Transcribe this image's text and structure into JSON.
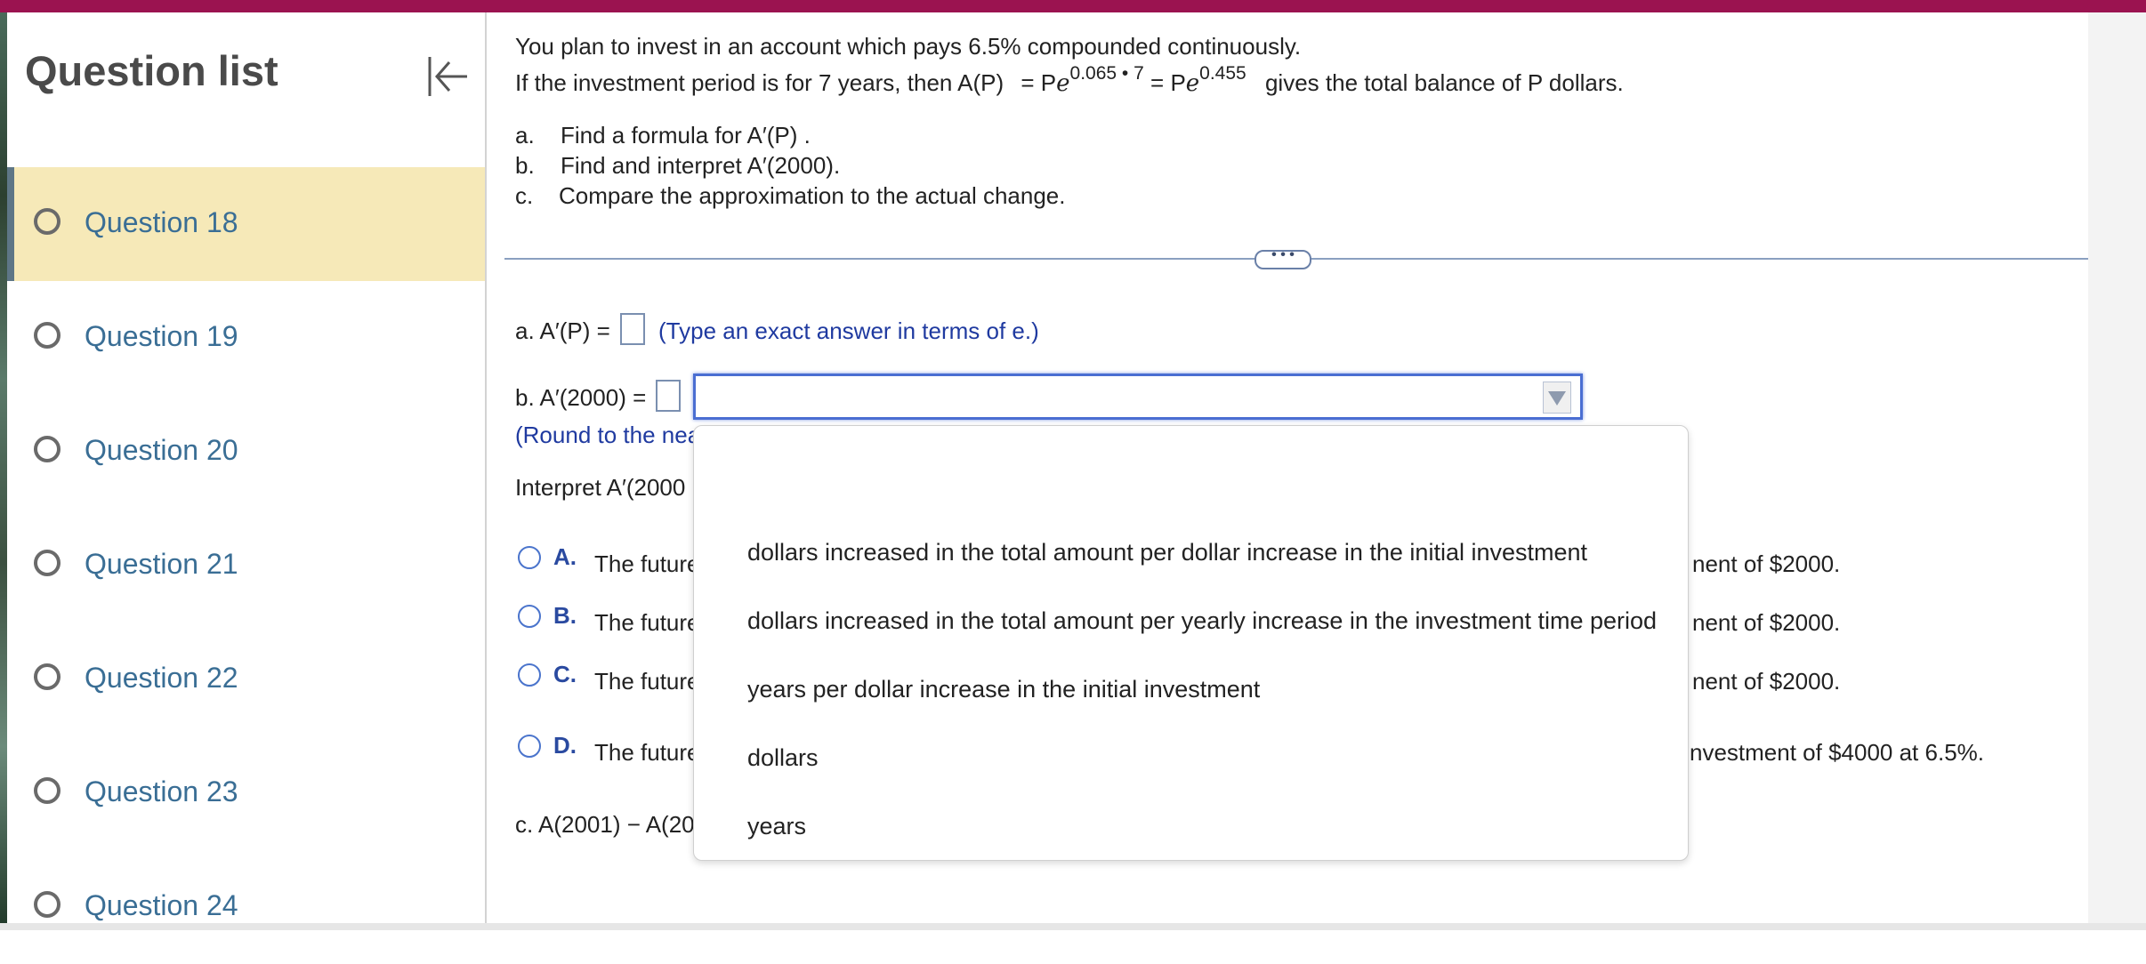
{
  "sidebar": {
    "title": "Question list",
    "questions": [
      {
        "label": "Question 18"
      },
      {
        "label": "Question 19"
      },
      {
        "label": "Question 20"
      },
      {
        "label": "Question 21"
      },
      {
        "label": "Question 22"
      },
      {
        "label": "Question 23"
      },
      {
        "label": "Question 24"
      }
    ],
    "active_question": "Question 18"
  },
  "problem": {
    "line1": "You plan to invest in an account which pays 6.5% compounded continuously.",
    "line2_prefix": "If the investment period is for 7 years, then A(P)",
    "formula_eq1": "= P",
    "formula_e1": "e",
    "formula_exp1": "0.065 • 7",
    "formula_eq2": "= P",
    "formula_e2": "e",
    "formula_exp2": "0.455",
    "line2_suffix": "gives the total balance of P dollars.",
    "parts": [
      {
        "letter": "a.",
        "text": "Find a formula for A′(P) ."
      },
      {
        "letter": "b.",
        "text": "Find and interpret A′(2000)."
      },
      {
        "letter": "c.",
        "text": "Compare the approximation to the actual change."
      }
    ]
  },
  "more_button": "• • •",
  "answers": {
    "a_label": "a. A′(P) =",
    "a_hint": "(Type an exact answer in terms of e.)",
    "b_label": "b. A′(2000) =",
    "b_round_hint": "(Round to the nea",
    "interpret_label": "Interpret A′(2000",
    "options": [
      {
        "letter": "A.",
        "text_left": "The future",
        "text_right": "nent of $2000."
      },
      {
        "letter": "B.",
        "text_left": "The future",
        "text_right": "nent of $2000."
      },
      {
        "letter": "C.",
        "text_left": "The future",
        "text_right": "nent of $2000."
      },
      {
        "letter": "D.",
        "text_left": "The future",
        "text_right": "nvestment of $4000 at 6.5%."
      }
    ],
    "c_label": "c. A(2001) − A(20"
  },
  "dropdown": {
    "items": [
      "dollars increased in the total amount per dollar increase in the initial investment",
      "dollars increased in the total amount per yearly increase in the investment time period",
      "years per dollar increase in the initial investment",
      "dollars",
      "years"
    ]
  },
  "colors": {
    "top_bar": "#9b1350",
    "active_item_bg": "#f6e9b8",
    "link_blue": "#3a6e95",
    "hint_blue": "#1f3aa0"
  }
}
